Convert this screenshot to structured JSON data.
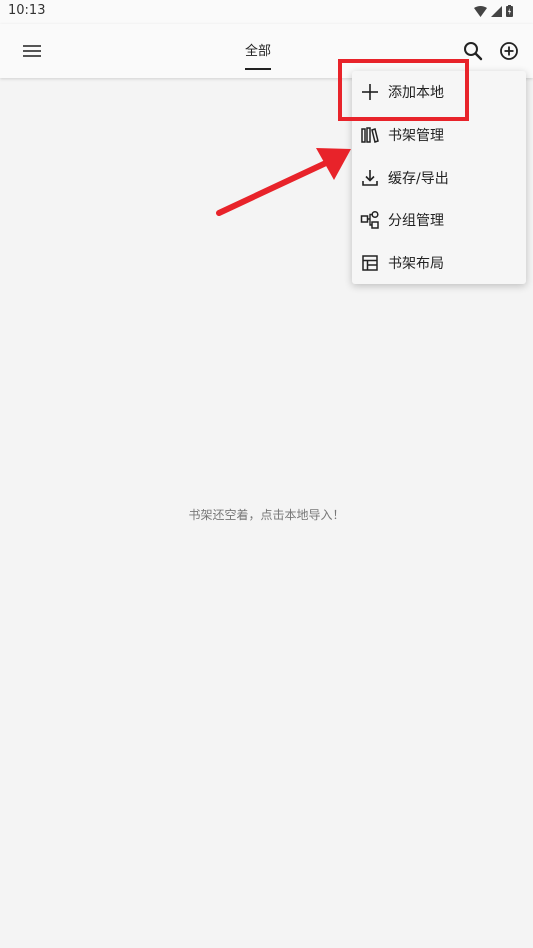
{
  "status_bar": {
    "time": "10:13"
  },
  "app_bar": {
    "tab_label": "全部"
  },
  "menu": {
    "items": [
      {
        "label": "添加本地",
        "icon": "plus-icon"
      },
      {
        "label": "书架管理",
        "icon": "bookshelf-icon"
      },
      {
        "label": "缓存/导出",
        "icon": "download-icon"
      },
      {
        "label": "分组管理",
        "icon": "group-icon"
      },
      {
        "label": "书架布局",
        "icon": "layout-icon"
      }
    ]
  },
  "empty_message": "书架还空着，点击本地导入！",
  "annotation_color": "#e8232a"
}
